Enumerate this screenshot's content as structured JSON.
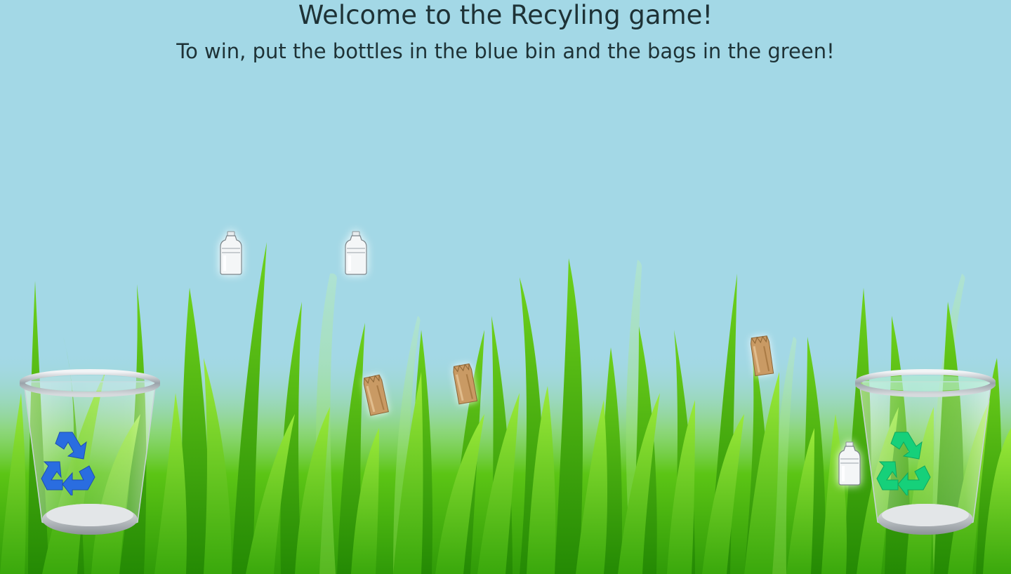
{
  "header": {
    "title": "Welcome to the Recyling game!",
    "subtitle": "To win, put the bottles in the blue bin and the bags in the green!"
  },
  "colors": {
    "sky": "#a3d8e6",
    "grass_light": "#8ee82a",
    "grass_dark": "#3aa80c",
    "blue_bin_symbol": "#2a6de0",
    "green_bin_symbol": "#16d07a",
    "text": "#1e3236"
  },
  "bins": [
    {
      "name": "blue-bin",
      "accepts": "bottles",
      "icon": "recycle-icon"
    },
    {
      "name": "green-bin",
      "accepts": "bags",
      "icon": "recycle-icon"
    }
  ],
  "items": [
    {
      "type": "bottle",
      "icon": "bottle-icon"
    },
    {
      "type": "bottle",
      "icon": "bottle-icon"
    },
    {
      "type": "bag",
      "icon": "paper-bag-icon"
    },
    {
      "type": "bag",
      "icon": "paper-bag-icon"
    },
    {
      "type": "bag",
      "icon": "paper-bag-icon"
    },
    {
      "type": "bottle",
      "icon": "bottle-icon"
    }
  ]
}
